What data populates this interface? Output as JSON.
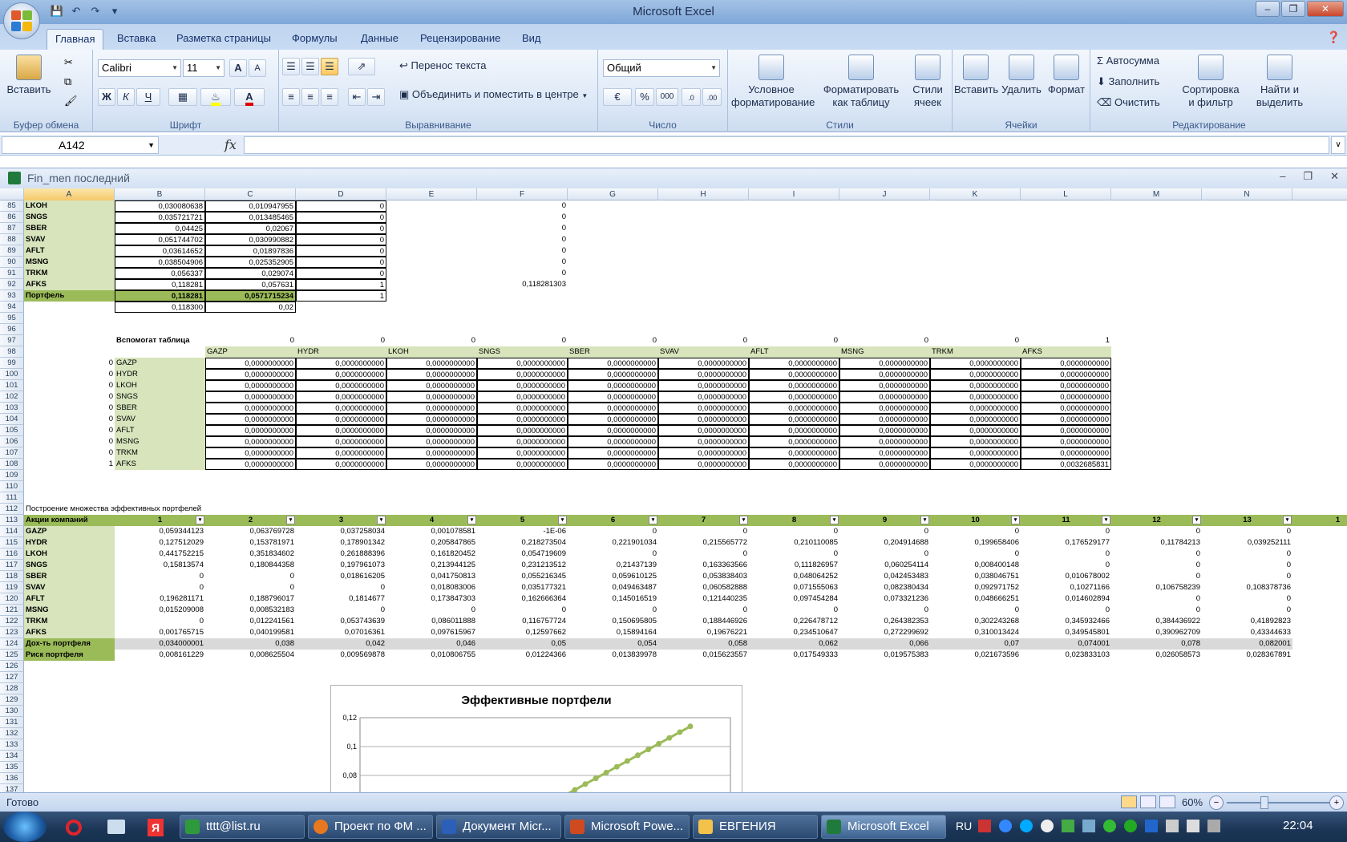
{
  "app": {
    "title": "Microsoft Excel"
  },
  "ribbon": {
    "tabs": [
      "Главная",
      "Вставка",
      "Разметка страницы",
      "Формулы",
      "Данные",
      "Рецензирование",
      "Вид"
    ],
    "clipboard": {
      "paste": "Вставить",
      "label": "Буфер обмена"
    },
    "font": {
      "name": "Calibri",
      "size": "11",
      "bold": "Ж",
      "italic": "К",
      "underline": "Ч",
      "grow": "A",
      "shrink": "A",
      "color_letter": "A",
      "label": "Шрифт"
    },
    "align": {
      "wrap": "Перенос текста",
      "merge": "Объединить и поместить в центре",
      "label": "Выравнивание"
    },
    "number": {
      "format": "Общий",
      "percent": "%",
      "thousands": "000",
      "label": "Число"
    },
    "styles": {
      "cond1": "Условное",
      "cond2": "форматирование",
      "fmt1": "Форматировать",
      "fmt2": "как таблицу",
      "cell1": "Стили",
      "cell2": "ячеек",
      "label": "Стили"
    },
    "cells": {
      "insert": "Вставить",
      "delete": "Удалить",
      "format": "Формат",
      "label": "Ячейки"
    },
    "edit": {
      "autosum": "Автосумма",
      "fill": "Заполнить",
      "clear": "Очистить",
      "sort1": "Сортировка",
      "sort2": "и фильтр",
      "find1": "Найти и",
      "find2": "выделить",
      "label": "Редактирование"
    }
  },
  "formula": {
    "namebox": "A142",
    "fx": "fx"
  },
  "workbook": {
    "title": "Fin_men последний"
  },
  "columns": [
    "A",
    "B",
    "C",
    "D",
    "E",
    "F",
    "G",
    "H",
    "I",
    "J",
    "K",
    "L",
    "M",
    "N"
  ],
  "top_rows": [
    {
      "n": "85",
      "a": "LKOH",
      "b": "0,030080638",
      "c": "0,010947955",
      "d": "0",
      "f": "0"
    },
    {
      "n": "86",
      "a": "SNGS",
      "b": "0,035721721",
      "c": "0,013485465",
      "d": "0",
      "f": "0"
    },
    {
      "n": "87",
      "a": "SBER",
      "b": "0,04425",
      "c": "0,02067",
      "d": "0",
      "f": "0"
    },
    {
      "n": "88",
      "a": "SVAV",
      "b": "0,051744702",
      "c": "0,030990882",
      "d": "0",
      "f": "0"
    },
    {
      "n": "89",
      "a": "AFLT",
      "b": "0,03614652",
      "c": "0,01897836",
      "d": "0",
      "f": "0"
    },
    {
      "n": "90",
      "a": "MSNG",
      "b": "0,038504906",
      "c": "0,025352905",
      "d": "0",
      "f": "0"
    },
    {
      "n": "91",
      "a": "TRKM",
      "b": "0,056337",
      "c": "0,029074",
      "d": "0",
      "f": "0"
    },
    {
      "n": "92",
      "a": "AFKS",
      "b": "0,118281",
      "c": "0,057631",
      "d": "1",
      "f": "0,118281303"
    }
  ],
  "row93": {
    "n": "93",
    "a": "Портфель",
    "b": "0,118281",
    "c": "0,0571715234",
    "d": "1"
  },
  "row94": {
    "n": "94",
    "b": "0,118300",
    "c": "0,02"
  },
  "aux": {
    "title": "Вспомогат таблица",
    "row97": [
      "0",
      "0",
      "0",
      "0",
      "0",
      "0",
      "0",
      "0",
      "0",
      "1"
    ],
    "headers": [
      "GAZP",
      "HYDR",
      "LKOH",
      "SNGS",
      "SBER",
      "SVAV",
      "AFLT",
      "MSNG",
      "TRKM",
      "AFKS"
    ],
    "rows": [
      {
        "n": "99",
        "a": "0",
        "name": "GAZP",
        "last": "0,0000000000"
      },
      {
        "n": "100",
        "a": "0",
        "name": "HYDR",
        "last": "0,0000000000"
      },
      {
        "n": "101",
        "a": "0",
        "name": "LKOH",
        "last": "0,0000000000"
      },
      {
        "n": "102",
        "a": "0",
        "name": "SNGS",
        "last": "0,0000000000"
      },
      {
        "n": "103",
        "a": "0",
        "name": "SBER",
        "last": "0,0000000000"
      },
      {
        "n": "104",
        "a": "0",
        "name": "SVAV",
        "last": "0,0000000000"
      },
      {
        "n": "105",
        "a": "0",
        "name": "AFLT",
        "last": "0,0000000000"
      },
      {
        "n": "106",
        "a": "0",
        "name": "MSNG",
        "last": "0,0000000000"
      },
      {
        "n": "107",
        "a": "0",
        "name": "TRKM",
        "last": "0,0000000000"
      },
      {
        "n": "108",
        "a": "1",
        "name": "AFKS",
        "last": "0,0032685831"
      }
    ],
    "zero": "0,0000000000"
  },
  "eff": {
    "title": "Построение множества эффективных портфелей",
    "header": "Акции компаний",
    "cols": [
      "1",
      "2",
      "3",
      "4",
      "5",
      "6",
      "7",
      "8",
      "9",
      "10",
      "11",
      "12",
      "13",
      "1"
    ],
    "rows": [
      {
        "n": "114",
        "name": "GAZP",
        "v": [
          "0,059344123",
          "0,063769728",
          "0,037258034",
          "0,001078581",
          "-1E-06",
          "0",
          "0",
          "0",
          "0",
          "0",
          "0",
          "0",
          "0"
        ]
      },
      {
        "n": "115",
        "name": "HYDR",
        "v": [
          "0,127512029",
          "0,153781971",
          "0,178901342",
          "0,205847865",
          "0,218273504",
          "0,221901034",
          "0,215565772",
          "0,210110085",
          "0,204914688",
          "0,199658406",
          "0,176529177",
          "0,11784213",
          "0,039252111"
        ]
      },
      {
        "n": "116",
        "name": "LKOH",
        "v": [
          "0,441752215",
          "0,351834602",
          "0,261888396",
          "0,161820452",
          "0,054719609",
          "0",
          "0",
          "0",
          "0",
          "0",
          "0",
          "0",
          "0"
        ]
      },
      {
        "n": "117",
        "name": "SNGS",
        "v": [
          "0,15813574",
          "0,180844358",
          "0,197961073",
          "0,213944125",
          "0,231213512",
          "0,21437139",
          "0,163363566",
          "0,111826957",
          "0,060254114",
          "0,008400148",
          "0",
          "0",
          "0"
        ]
      },
      {
        "n": "118",
        "name": "SBER",
        "v": [
          "0",
          "0",
          "0,018616205",
          "0,041750813",
          "0,055216345",
          "0,059610125",
          "0,053838403",
          "0,048064252",
          "0,042453483",
          "0,038046751",
          "0,010678002",
          "0",
          "0"
        ]
      },
      {
        "n": "119",
        "name": "SVAV",
        "v": [
          "0",
          "0",
          "0",
          "0,018083006",
          "0,035177321",
          "0,049463487",
          "0,060582888",
          "0,071555063",
          "0,082380434",
          "0,092971752",
          "0,10271166",
          "0,106758239",
          "0,108378736"
        ]
      },
      {
        "n": "120",
        "name": "AFLT",
        "v": [
          "0,196281171",
          "0,188796017",
          "0,1814677",
          "0,173847303",
          "0,162666364",
          "0,145016519",
          "0,121440235",
          "0,097454284",
          "0,073321236",
          "0,048666251",
          "0,014602894",
          "0",
          "0"
        ]
      },
      {
        "n": "121",
        "name": "MSNG",
        "v": [
          "0,015209008",
          "0,008532183",
          "0",
          "0",
          "0",
          "0",
          "0",
          "0",
          "0",
          "0",
          "0",
          "0",
          "0"
        ]
      },
      {
        "n": "122",
        "name": "TRKM",
        "v": [
          "0",
          "0,012241561",
          "0,053743639",
          "0,086011888",
          "0,116757724",
          "0,150695805",
          "0,188446926",
          "0,226478712",
          "0,264382353",
          "0,302243268",
          "0,345932466",
          "0,384436922",
          "0,41892823"
        ]
      },
      {
        "n": "123",
        "name": "AFKS",
        "v": [
          "0,001765715",
          "0,040199581",
          "0,07016361",
          "0,097615967",
          "0,12597662",
          "0,15894164",
          "0,19676221",
          "0,234510647",
          "0,272299692",
          "0,310013424",
          "0,349545801",
          "0,390962709",
          "0,43344633"
        ]
      }
    ],
    "ret": {
      "n": "124",
      "name": "Дох-ть портфеля",
      "v": [
        "0,034000001",
        "0,038",
        "0,042",
        "0,046",
        "0,05",
        "0,054",
        "0,058",
        "0,062",
        "0,066",
        "0,07",
        "0,074001",
        "0,078",
        "0,082001"
      ]
    },
    "risk": {
      "n": "125",
      "name": "Риск портфеля",
      "v": [
        "0,008161229",
        "0,008625504",
        "0,009569878",
        "0,010806755",
        "0,01224366",
        "0,013839978",
        "0,015623557",
        "0,017549333",
        "0,019575383",
        "0,021673596",
        "0,023833103",
        "0,026058573",
        "0,028367891"
      ]
    }
  },
  "extra_rows": [
    "95",
    "96",
    "109",
    "110",
    "111",
    "126",
    "127",
    "128",
    "129",
    "130",
    "131",
    "132",
    "133",
    "134",
    "135",
    "136",
    "137"
  ],
  "labels": {
    "n97": "97",
    "n98": "98",
    "n112": "112",
    "n113": "113"
  },
  "chart_data": {
    "type": "line",
    "title": "Эффективные портфели",
    "x": [
      0.008161229,
      0.008625504,
      0.009569878,
      0.010806755,
      0.01224366,
      0.013839978,
      0.015623557,
      0.017549333,
      0.019575383,
      0.021673596,
      0.023833103,
      0.026058573,
      0.028367891
    ],
    "y": [
      0.034000001,
      0.038,
      0.042,
      0.046,
      0.05,
      0.054,
      0.058,
      0.062,
      0.066,
      0.07,
      0.074001,
      0.078,
      0.082001,
      0.086,
      0.09,
      0.094,
      0.098,
      0.102,
      0.106,
      0.11,
      0.114
    ],
    "y_ticks": [
      "0,12",
      "0,1",
      "0,08"
    ],
    "ylim": [
      0,
      0.12
    ],
    "grid": true,
    "color": "#9bbb59"
  },
  "status": {
    "ready": "Готово",
    "zoom": "60%"
  },
  "taskbar": {
    "items": [
      "tttt@list.ru",
      "Проект по ФМ ...",
      "Документ Micr...",
      "Microsoft Powe...",
      "ЕВГЕНИЯ",
      "Microsoft Excel"
    ],
    "lang": "RU",
    "time": "22:04"
  }
}
